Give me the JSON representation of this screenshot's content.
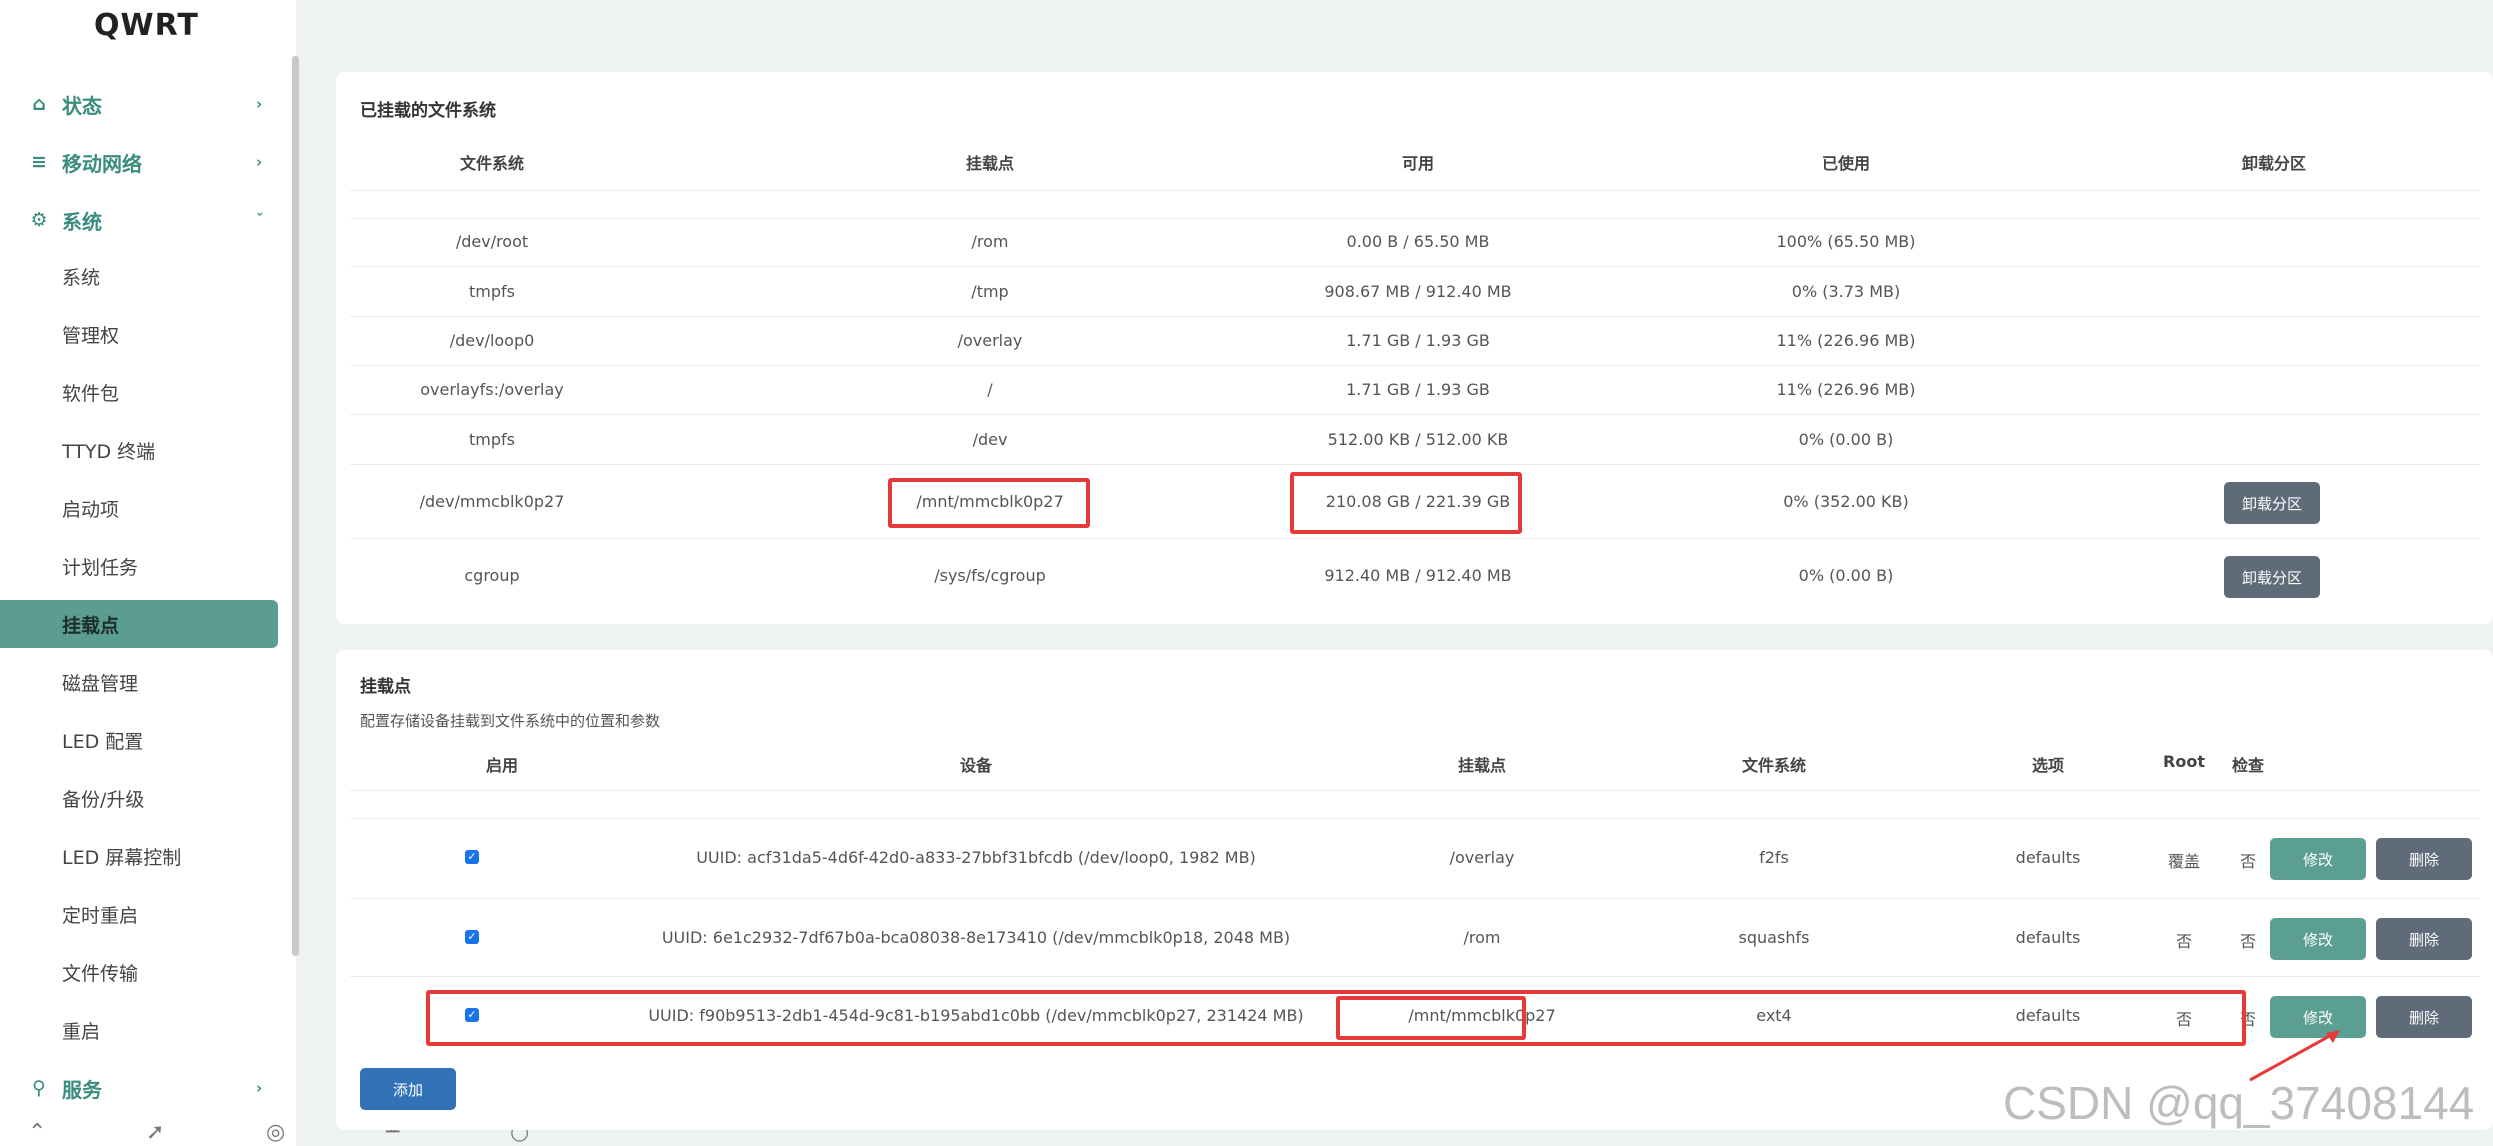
{
  "brand": "QWRT",
  "nav": {
    "status": "状态",
    "mobile": "移动网络",
    "system": "系统",
    "sub": [
      "系统",
      "管理权",
      "软件包",
      "TTYD 终端",
      "启动项",
      "计划任务",
      "挂载点",
      "磁盘管理",
      "LED 配置",
      "备份/升级",
      "LED 屏幕控制",
      "定时重启",
      "文件传输",
      "重启"
    ],
    "services": "服务"
  },
  "mounted": {
    "title": "已挂载的文件系统",
    "headers": [
      "文件系统",
      "挂载点",
      "可用",
      "已使用",
      "卸载分区"
    ],
    "rows": [
      {
        "fs": "/dev/root",
        "mp": "/rom",
        "avail": "0.00 B / 65.50 MB",
        "used": "100% (65.50 MB)"
      },
      {
        "fs": "tmpfs",
        "mp": "/tmp",
        "avail": "908.67 MB / 912.40 MB",
        "used": "0% (3.73 MB)"
      },
      {
        "fs": "/dev/loop0",
        "mp": "/overlay",
        "avail": "1.71 GB / 1.93 GB",
        "used": "11% (226.96 MB)"
      },
      {
        "fs": "overlayfs:/overlay",
        "mp": "/",
        "avail": "1.71 GB / 1.93 GB",
        "used": "11% (226.96 MB)"
      },
      {
        "fs": "tmpfs",
        "mp": "/dev",
        "avail": "512.00 KB / 512.00 KB",
        "used": "0% (0.00 B)"
      },
      {
        "fs": "/dev/mmcblk0p27",
        "mp": "/mnt/mmcblk0p27",
        "avail": "210.08 GB / 221.39 GB",
        "used": "0% (352.00 KB)",
        "btn": "卸载分区"
      },
      {
        "fs": "cgroup",
        "mp": "/sys/fs/cgroup",
        "avail": "912.40 MB / 912.40 MB",
        "used": "0% (0.00 B)",
        "btn": "卸载分区"
      }
    ]
  },
  "mountpoints": {
    "title": "挂载点",
    "desc": "配置存储设备挂载到文件系统中的位置和参数",
    "headers": [
      "启用",
      "设备",
      "挂载点",
      "文件系统",
      "选项",
      "Root",
      "检查"
    ],
    "rows": [
      {
        "device": "UUID: acf31da5-4d6f-42d0-a833-27bbf31bfcdb (/dev/loop0, 1982 MB)",
        "mp": "/overlay",
        "fs": "f2fs",
        "opt": "defaults",
        "root": "覆盖",
        "check": "否"
      },
      {
        "device": "UUID: 6e1c2932-7df67b0a-bca08038-8e173410 (/dev/mmcblk0p18, 2048 MB)",
        "mp": "/rom",
        "fs": "squashfs",
        "opt": "defaults",
        "root": "否",
        "check": "否"
      },
      {
        "device": "UUID: f90b9513-2db1-454d-9c81-b195abd1c0bb (/dev/mmcblk0p27, 231424 MB)",
        "mp": "/mnt/mmcblk0p27",
        "fs": "ext4",
        "opt": "defaults",
        "root": "否",
        "check": "否"
      }
    ],
    "edit": "修改",
    "delete": "删除",
    "add": "添加"
  },
  "watermark": "CSDN @qq_37408144",
  "colors": {
    "accent": "#5b9d90",
    "highlight": "#e63a3a",
    "add_button": "#3273b8"
  }
}
